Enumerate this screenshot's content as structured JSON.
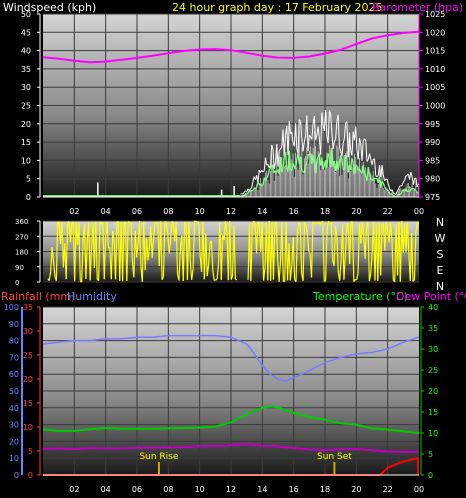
{
  "header": {
    "windspeed_label": "Windspeed (kph)",
    "title": "24 hour graph day : 17 February 2025",
    "barometer_label": "Barometer (hpa)"
  },
  "colors": {
    "background": "#000000",
    "wind_label": "#ffffff",
    "title": "#ffff00",
    "barometer": "#ff00ff",
    "gust": "#ffffff",
    "wind_avg": "#80ff80",
    "direction": "#ffff00",
    "rain_axis": "#ff4040",
    "humidity": "#7b7bff",
    "temperature": "#00cc00",
    "dew_point": "#c000c0",
    "rain_line": "#ff0000",
    "temperature_label": "#00ff00",
    "dew_label": "#ff00ff",
    "sun_marker": "#ccaa00"
  },
  "time_axis_labels": [
    "02",
    "04",
    "06",
    "08",
    "10",
    "12",
    "14",
    "16",
    "18",
    "20",
    "22",
    "00"
  ],
  "direction_letters": [
    "N",
    "W",
    "S",
    "E",
    "N"
  ],
  "bottom_labels": {
    "rainfall": "Rainfall (mm)",
    "humidity": "Humidity",
    "temperature": "Temperature (°C)",
    "dew_point": "Dew Point (°C)",
    "sun_rise": "Sun Rise",
    "sun_set": "Sun Set"
  },
  "chart_data": [
    {
      "type": "line",
      "xlabel": "",
      "ylabel": "Windspeed (kph)",
      "ylabel_right": "Barometer (hpa)",
      "x_hours": [
        0,
        24
      ],
      "ylim": [
        0,
        50
      ],
      "y_ticks": [
        0,
        5,
        10,
        15,
        20,
        25,
        30,
        35,
        40,
        45,
        50
      ],
      "ylim_right": [
        975,
        1025
      ],
      "y_ticks_right": [
        975,
        980,
        985,
        990,
        995,
        1000,
        1005,
        1010,
        1015,
        1020,
        1025
      ],
      "series": [
        {
          "name": "Barometer (hpa)",
          "axis": "right",
          "x": [
            0,
            1,
            2,
            3,
            4,
            5,
            6,
            7,
            8,
            9,
            10,
            11,
            12,
            13,
            14,
            15,
            16,
            17,
            18,
            19,
            20,
            21,
            22,
            23,
            24
          ],
          "values": [
            1013.2,
            1012.8,
            1012.2,
            1011.8,
            1012,
            1012.5,
            1013,
            1013.6,
            1014.3,
            1014.9,
            1015.3,
            1015.4,
            1015.1,
            1014.4,
            1013.6,
            1013.1,
            1013,
            1013.4,
            1014.2,
            1015.2,
            1016.8,
            1018.3,
            1019.2,
            1019.8,
            1020.2
          ]
        }
      ],
      "gust_envelope": {
        "x": [
          12.6,
          13,
          13.5,
          14,
          14.5,
          15,
          15.5,
          16,
          16.5,
          17,
          17.5,
          18,
          18.5,
          19,
          19.5,
          20,
          20.5,
          21,
          21.5,
          22,
          22.5,
          23,
          23.5,
          24
        ],
        "values": [
          1,
          2,
          5,
          8,
          12,
          15,
          18,
          22,
          21,
          20,
          19,
          21,
          22,
          20,
          18,
          17,
          15,
          12,
          9,
          4,
          1,
          5,
          7,
          3
        ]
      },
      "wind_avg_envelope": {
        "x": [
          12.6,
          13,
          13.5,
          14,
          14.5,
          15,
          15.5,
          16,
          16.5,
          17,
          17.5,
          18,
          18.5,
          19,
          19.5,
          20,
          20.5,
          21,
          21.5,
          22,
          22.5,
          23,
          23.5,
          24
        ],
        "values": [
          0,
          1,
          3,
          5,
          8,
          10,
          12,
          13,
          12,
          11,
          11,
          12,
          13,
          12,
          10,
          10,
          8,
          7,
          5,
          2,
          0,
          2,
          3,
          1
        ]
      }
    },
    {
      "type": "scatter",
      "ylabel": "Wind direction (°)",
      "ylim": [
        0,
        360
      ],
      "y_ticks": [
        0,
        90,
        180,
        270,
        360
      ],
      "y_tick_labels": [
        "0",
        "90",
        "180",
        "270",
        "360"
      ],
      "extra_tick_labels": [
        "0",
        "90",
        "180",
        "270",
        "360"
      ]
    },
    {
      "type": "line",
      "ylabel": "Humidity",
      "ylim": [
        0,
        100
      ],
      "y_ticks": [
        0,
        10,
        20,
        30,
        40,
        50,
        60,
        70,
        80,
        90,
        100
      ],
      "ylim_rain": [
        0,
        35
      ],
      "y_ticks_rain": [
        0,
        5,
        10,
        15,
        20,
        25,
        30,
        35
      ],
      "ylim_right": [
        0,
        40
      ],
      "y_ticks_right": [
        0,
        5,
        10,
        15,
        20,
        25,
        30,
        35,
        40
      ],
      "series": [
        {
          "name": "Humidity",
          "axis": "left",
          "x": [
            0,
            1,
            2,
            3,
            4,
            5,
            6,
            7,
            8,
            9,
            10,
            11,
            12,
            13,
            13.5,
            14,
            14.5,
            15,
            15.5,
            16,
            17,
            18,
            19,
            20,
            21,
            22,
            23,
            24
          ],
          "values": [
            78,
            79,
            80,
            80,
            81,
            81,
            82,
            82,
            83,
            83,
            83,
            83,
            82,
            78,
            72,
            65,
            60,
            57,
            56,
            58,
            62,
            67,
            70,
            72,
            73,
            75,
            79,
            82
          ]
        },
        {
          "name": "Temperature (°C)",
          "axis": "right",
          "x": [
            0,
            1,
            2,
            3,
            4,
            5,
            6,
            7,
            8,
            9,
            10,
            11,
            12,
            13,
            14,
            14.5,
            15,
            16,
            17,
            18,
            19,
            20,
            21,
            22,
            23,
            24
          ],
          "values": [
            10.8,
            10.5,
            10.5,
            10.9,
            11.2,
            11,
            11,
            11,
            11.1,
            11.2,
            11.3,
            11.5,
            12.5,
            14.5,
            16,
            16.3,
            16.1,
            14.8,
            13.8,
            13.2,
            12.3,
            12,
            11.1,
            10.8,
            10.4,
            10
          ]
        },
        {
          "name": "Dew Point (°C)",
          "axis": "right",
          "x": [
            0,
            1,
            2,
            3,
            4,
            5,
            6,
            7,
            8,
            9,
            10,
            11,
            12,
            13,
            14,
            15,
            16,
            17,
            18,
            19,
            20,
            21,
            22,
            23,
            24
          ],
          "values": [
            6.2,
            6.3,
            6.2,
            6.4,
            6.3,
            6.3,
            6.5,
            6.5,
            6.6,
            6.6,
            6.8,
            6.9,
            7.1,
            7.4,
            7,
            6.8,
            6.4,
            6.1,
            5.9,
            6.1,
            6.2,
            5.9,
            5.6,
            5.5,
            5.5
          ]
        },
        {
          "name": "Rainfall (mm)",
          "axis": "rain",
          "x": [
            0,
            21.5,
            22,
            22.5,
            23,
            23.5,
            24
          ],
          "values": [
            0,
            0,
            1.5,
            2.2,
            2.8,
            3.2,
            3.6
          ]
        }
      ],
      "sun_rise_hour": 7.4,
      "sun_set_hour": 18.6
    }
  ]
}
